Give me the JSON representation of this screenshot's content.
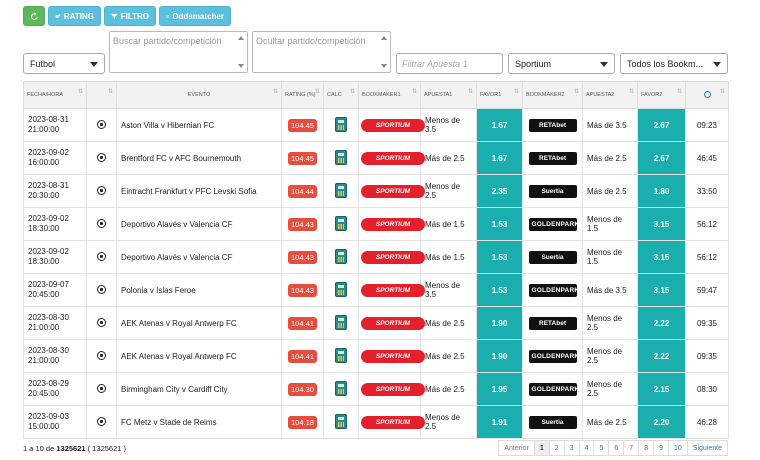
{
  "toolbar": {
    "rating_label": "RATING",
    "filtro_label": "FILTRO",
    "oddsmatcher_label": "Oddsmatcher"
  },
  "filters": {
    "sport_value": "Futbol",
    "search_placeholder": "Buscar partido/competición",
    "hide_placeholder": "Ocultar partido/competición",
    "bet_filter_placeholder": "Filtrar Apuesta 1",
    "bookmaker_value": "Sportium",
    "all_bookmakers_value": "Todos los Bookm..."
  },
  "table": {
    "headers": {
      "fecha": "FECHA/HORA",
      "evento": "EVENTO",
      "rating": "RATING (%)",
      "calc": "CALC",
      "bookmaker1": "BOOKMAKER1",
      "apuesta1": "APUESTA1",
      "favor1": "FAVOR1",
      "bookmaker2": "BOOKMAKER2",
      "apuesta2": "APUESTA2",
      "favor2": "FAVOR2"
    },
    "rows": [
      {
        "date": "2023-08-31",
        "time": "21:00:00",
        "event": "Aston Villa v Hibernian FC",
        "rating": "104.45",
        "bk1": "SPORTIUM",
        "bet1": "Menos de 3.5",
        "favor1": "1.67",
        "bk2": "RETAbet",
        "bet2": "Más de 3.5",
        "favor2": "2.67",
        "clock": "09:23"
      },
      {
        "date": "2023-09-02",
        "time": "16:00:00",
        "event": "Brentford FC v AFC Bournemouth",
        "rating": "104.45",
        "bk1": "SPORTIUM",
        "bet1": "Más de 2.5",
        "favor1": "1.67",
        "bk2": "RETAbet",
        "bet2": "Más de 2.5",
        "favor2": "2.67",
        "clock": "46:45"
      },
      {
        "date": "2023-08-31",
        "time": "20:30:00",
        "event": "Eintracht Frankfurt v PFC Levski Sofia",
        "rating": "104.44",
        "bk1": "SPORTIUM",
        "bet1": "Menos de 2.5",
        "favor1": "2.35",
        "bk2": "Suertia",
        "bet2": "Más de 2.5",
        "favor2": "1.80",
        "clock": "33:50"
      },
      {
        "date": "2023-09-02",
        "time": "18:30:00",
        "event": "Deportivo Alavés v Valencia CF",
        "rating": "104.43",
        "bk1": "SPORTIUM",
        "bet1": "Más de 1.5",
        "favor1": "1.53",
        "bk2": "GOLDENPARK",
        "bet2": "Menos de 1.5",
        "favor2": "3.15",
        "clock": "56:12"
      },
      {
        "date": "2023-09-02",
        "time": "18:30:00",
        "event": "Deportivo Alavés v Valencia CF",
        "rating": "104.43",
        "bk1": "SPORTIUM",
        "bet1": "Más de 1.5",
        "favor1": "1.53",
        "bk2": "Suertia",
        "bet2": "Menos de 1.5",
        "favor2": "3.15",
        "clock": "56:12"
      },
      {
        "date": "2023-09-07",
        "time": "20:45:00",
        "event": "Polonia v Islas Feroe",
        "rating": "104.43",
        "bk1": "SPORTIUM",
        "bet1": "Menos de 3.5",
        "favor1": "1.53",
        "bk2": "GOLDENPARK",
        "bet2": "Más de 3.5",
        "favor2": "3.15",
        "clock": "59:47"
      },
      {
        "date": "2023-08-30",
        "time": "21:00:00",
        "event": "AEK Atenas v Royal Antwerp FC",
        "rating": "104.41",
        "bk1": "SPORTIUM",
        "bet1": "Más de 2.5",
        "favor1": "1.90",
        "bk2": "RETAbet",
        "bet2": "Menos de 2.5",
        "favor2": "2.22",
        "clock": "09:35"
      },
      {
        "date": "2023-08-30",
        "time": "21:00:00",
        "event": "AEK Atenas v Royal Antwerp FC",
        "rating": "104.41",
        "bk1": "SPORTIUM",
        "bet1": "Más de 2.5",
        "favor1": "1.90",
        "bk2": "GOLDENPARK",
        "bet2": "Menos de 2.5",
        "favor2": "2.22",
        "clock": "09:35"
      },
      {
        "date": "2023-08-29",
        "time": "20:45:00",
        "event": "Birmingham City v Cardiff City",
        "rating": "104.30",
        "bk1": "SPORTIUM",
        "bet1": "Más de 2.5",
        "favor1": "1.95",
        "bk2": "GOLDENPARK",
        "bet2": "Menos de 2.5",
        "favor2": "2.15",
        "clock": "08:30"
      },
      {
        "date": "2023-09-03",
        "time": "15:00:00",
        "event": "FC Metz v Stade de Reims",
        "rating": "104.18",
        "bk1": "SPORTIUM",
        "bet1": "Menos de 2.5",
        "favor1": "1.91",
        "bk2": "Suertia",
        "bet2": "Más de 2.5",
        "favor2": "2.20",
        "clock": "46:28"
      }
    ]
  },
  "footer": {
    "info_prefix": "1 a 10 de ",
    "info_total": "1325621",
    "info_suffix": " ( 1325621 )"
  },
  "pager": {
    "prev": "Anterior",
    "pages": [
      "1",
      "2",
      "3",
      "4",
      "5",
      "6",
      "7",
      "8",
      "9",
      "10"
    ],
    "next": "Siguiente"
  }
}
